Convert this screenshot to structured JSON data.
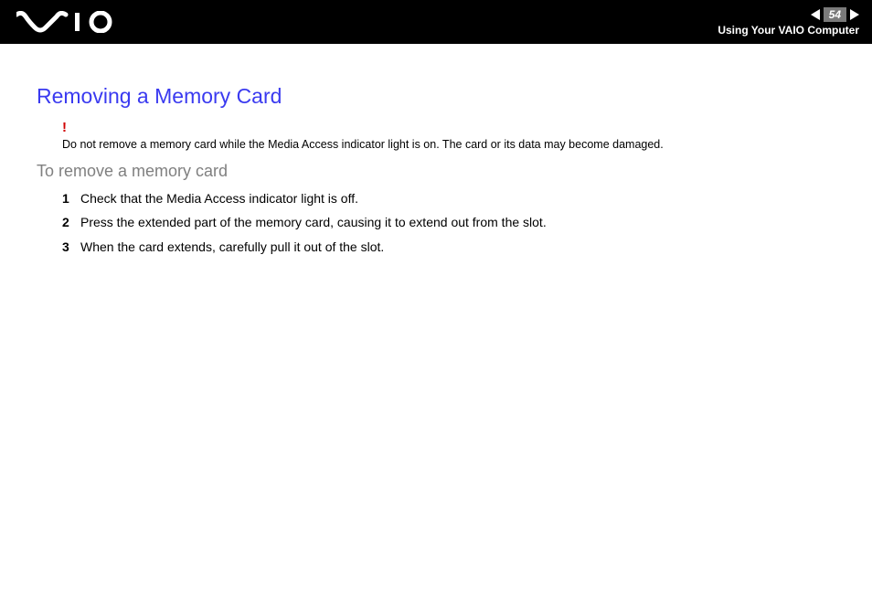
{
  "header": {
    "page_number": "54",
    "section": "Using Your VAIO Computer"
  },
  "content": {
    "title": "Removing a Memory Card",
    "warning_mark": "!",
    "warning_text": "Do not remove a memory card while the Media Access indicator light is on. The card or its data may become damaged.",
    "subhead": "To remove a memory card",
    "steps": [
      "Check that the Media Access indicator light is off.",
      "Press the extended part of the memory card, causing it to extend out from the slot.",
      "When the card extends, carefully pull it out of the slot."
    ]
  }
}
